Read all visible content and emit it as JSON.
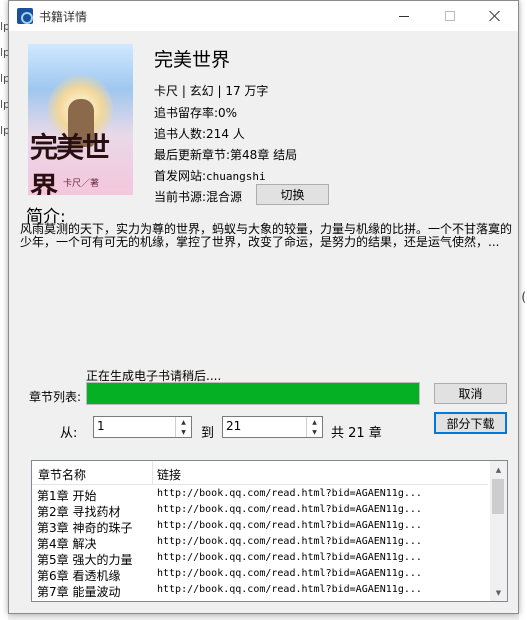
{
  "window": {
    "title": "书籍详情"
  },
  "cover": {
    "title": "完美世界",
    "author": "卡尺／著"
  },
  "book": {
    "title": "完美世界",
    "meta": "卡尺 | 玄幻 | 17 万字",
    "retention": "追书留存率:0%",
    "followers": "追书人数:214 人",
    "latest_chapter": "最后更新章节:第48章 结局",
    "first_site_label": "首发网站:",
    "first_site": "chuangshi",
    "source_label": "当前书源:混合源",
    "switch_button": "切换"
  },
  "intro": {
    "label": "简介:",
    "text": "风雨莫测的天下，实力为尊的世界，蚂蚁与大象的较量，力量与机缘的比拼。一个不甘落寞的少年，一个可有可无的机缘，掌控了世界，改变了命运，是努力的结果，还是运气使然，..."
  },
  "download": {
    "status": "正在生成电子书请稍后....",
    "chapter_list_label": "章节列表:",
    "progress": 1.0,
    "cancel_button": "取消",
    "partial_button": "部分下载",
    "from_label": "从:",
    "from_value": "1",
    "to_label": "到",
    "to_value": "21",
    "total_label": "共 21 章"
  },
  "chapters": {
    "col_name": "章节名称",
    "col_link": "链接",
    "rows": [
      {
        "name": "第1章 开始",
        "link": "http://book.qq.com/read.html?bid=AGAEN11g..."
      },
      {
        "name": "第2章 寻找药材",
        "link": "http://book.qq.com/read.html?bid=AGAEN11g..."
      },
      {
        "name": "第3章 神奇的珠子",
        "link": "http://book.qq.com/read.html?bid=AGAEN11g..."
      },
      {
        "name": "第4章 解决",
        "link": "http://book.qq.com/read.html?bid=AGAEN11g..."
      },
      {
        "name": "第5章 强大的力量",
        "link": "http://book.qq.com/read.html?bid=AGAEN11g..."
      },
      {
        "name": "第6章 看透机缘",
        "link": "http://book.qq.com/read.html?bid=AGAEN11g..."
      },
      {
        "name": "第7章 能量波动",
        "link": "http://book.qq.com/read.html?bid=AGAEN11g..."
      }
    ]
  },
  "colors": {
    "progress_fill": "#06b025",
    "default_button_border": "#0078d7"
  }
}
